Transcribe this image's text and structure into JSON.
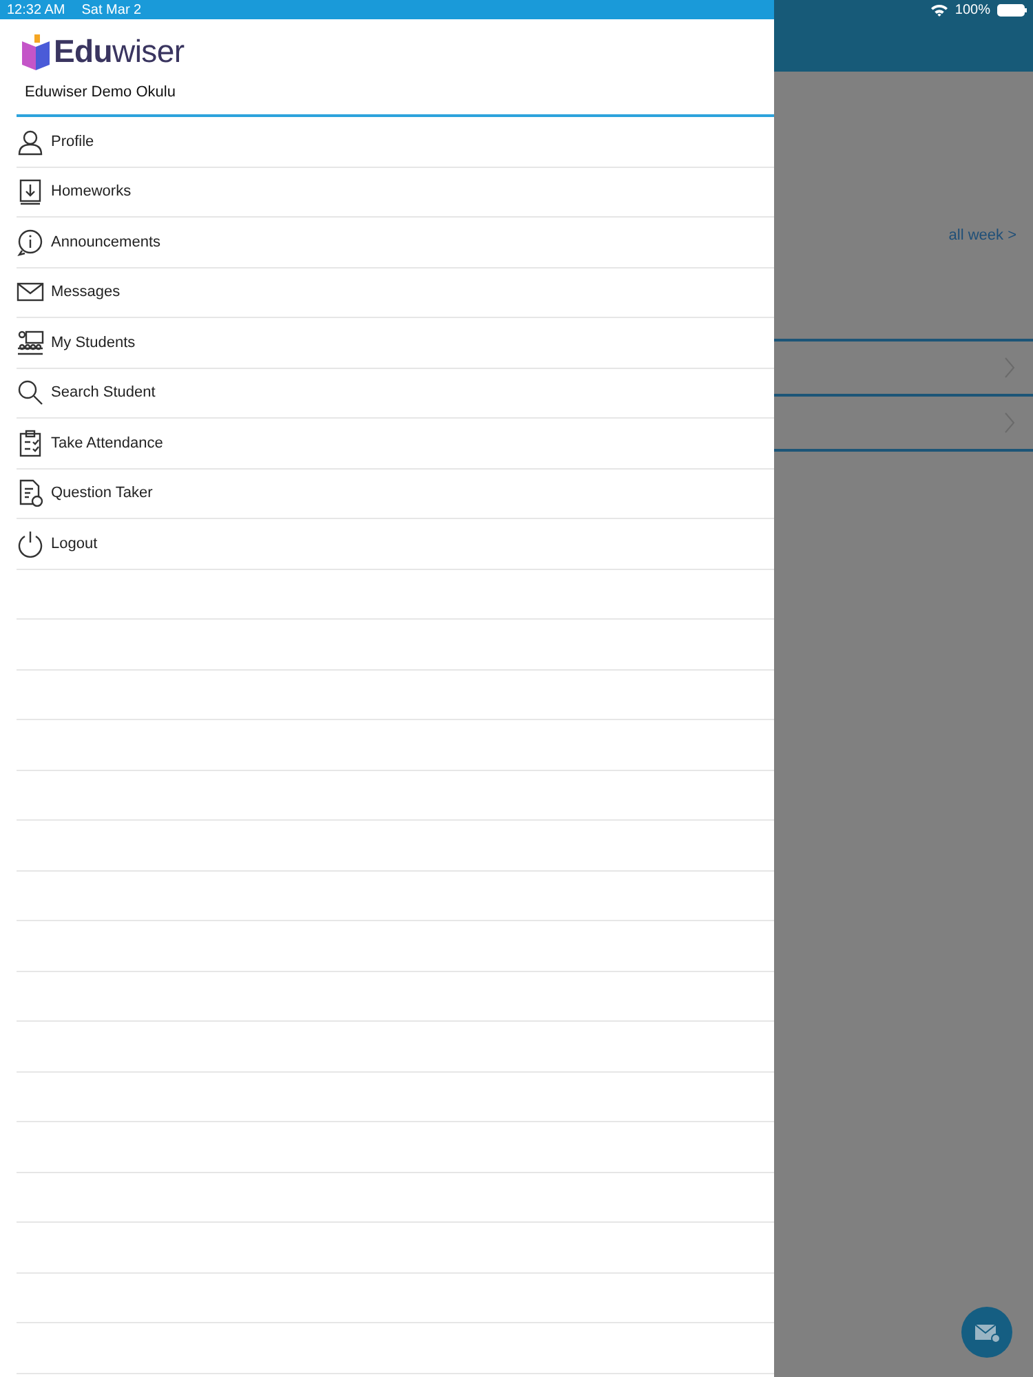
{
  "status_bar": {
    "time": "12:32 AM",
    "date": "Sat Mar 2",
    "battery": "100%"
  },
  "drawer": {
    "logo": {
      "bold": "Edu",
      "light": "wiser"
    },
    "school": "Eduwiser Demo Okulu",
    "items": [
      {
        "label": "Profile"
      },
      {
        "label": "Homeworks"
      },
      {
        "label": "Announcements"
      },
      {
        "label": "Messages"
      },
      {
        "label": "My Students"
      },
      {
        "label": "Search Student"
      },
      {
        "label": "Take Attendance"
      },
      {
        "label": "Question Taker"
      },
      {
        "label": "Logout"
      }
    ]
  },
  "background": {
    "link": "all week >"
  }
}
